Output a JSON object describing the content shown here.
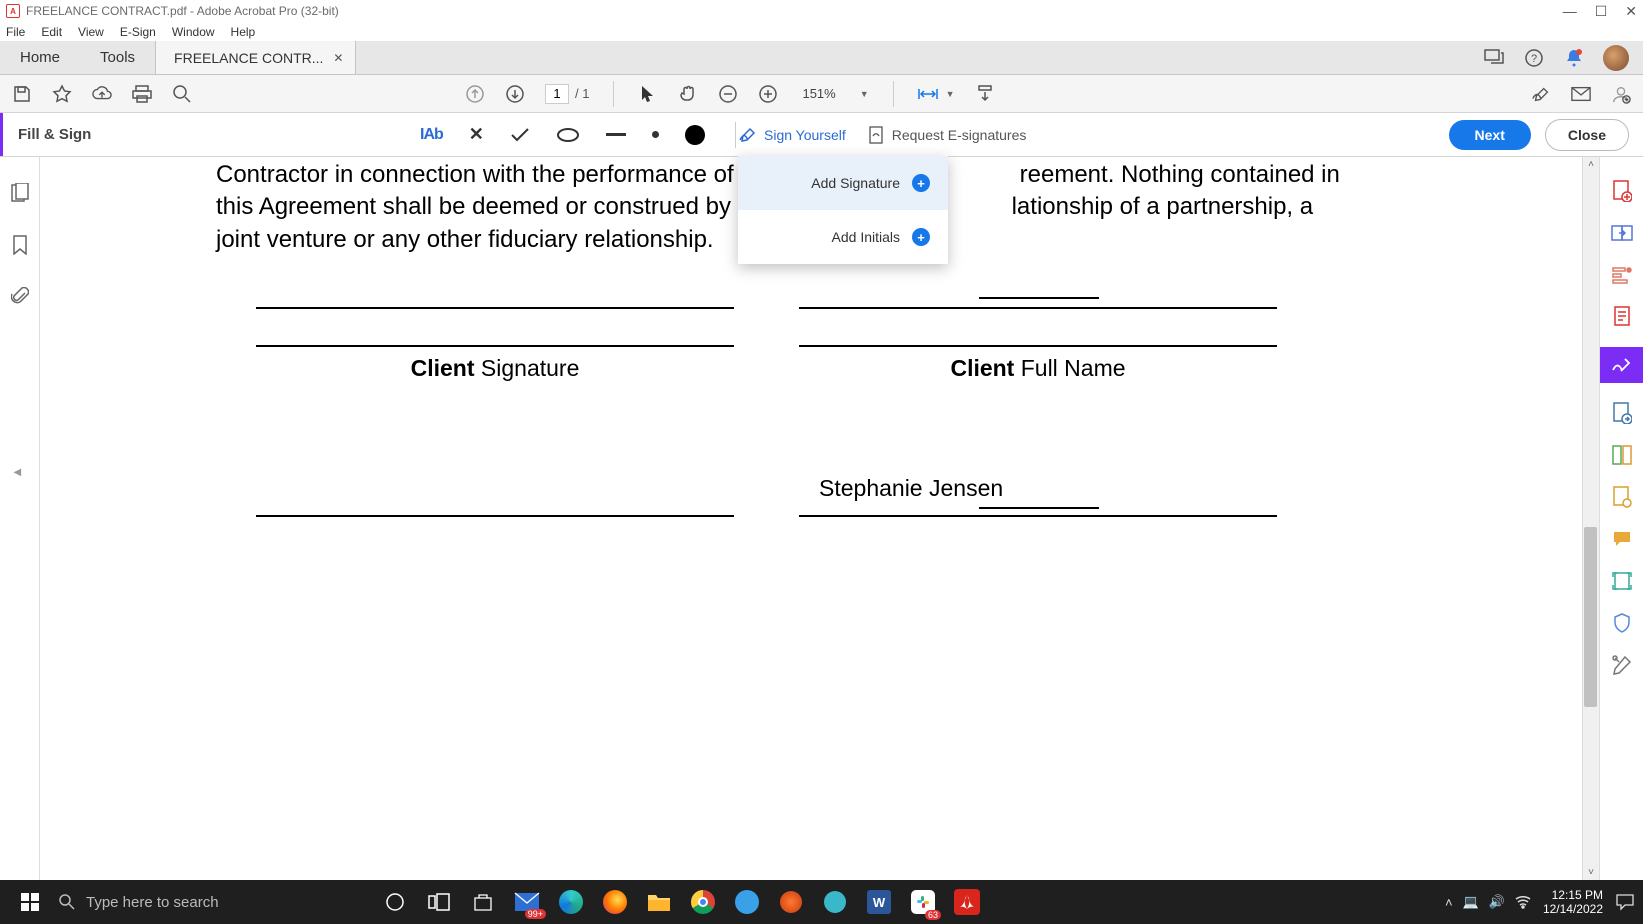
{
  "titlebar": {
    "filename": "FREELANCE CONTRACT.pdf",
    "app": "Adobe Acrobat Pro (32-bit)"
  },
  "menubar": {
    "file": "File",
    "edit": "Edit",
    "view": "View",
    "esign": "E-Sign",
    "window": "Window",
    "help": "Help"
  },
  "tabs": {
    "home": "Home",
    "tools": "Tools",
    "doc": "FREELANCE CONTR..."
  },
  "toolbar": {
    "page_current": "1",
    "page_sep": "/ 1",
    "zoom": "151%"
  },
  "fillsign": {
    "label": "Fill & Sign",
    "iab": "IAb",
    "sign_yourself": "Sign Yourself",
    "request": "Request E-signatures",
    "next": "Next",
    "close": "Close"
  },
  "signdd": {
    "add_sig": "Add Signature",
    "add_init": "Add Initials"
  },
  "doc": {
    "para_frag1": "Contractor in connection with the performance of the S",
    "para_frag2": "reement. Nothing contained in",
    "para_line2a": "this Agreement shall be deemed or construed by the P",
    "para_line2b": "lationship of a partnership, a",
    "para_line3": "joint venture or any other fiduciary relationship.",
    "client_sig_bold": "Client",
    "client_sig_rest": " Signature",
    "client_name_bold": "Client",
    "client_name_rest": " Full Name",
    "freelancer_name": "Stephanie Jensen"
  },
  "taskbar": {
    "search_placeholder": "Type here to search",
    "time": "12:15 PM",
    "date": "12/14/2022",
    "badge": "99+"
  }
}
